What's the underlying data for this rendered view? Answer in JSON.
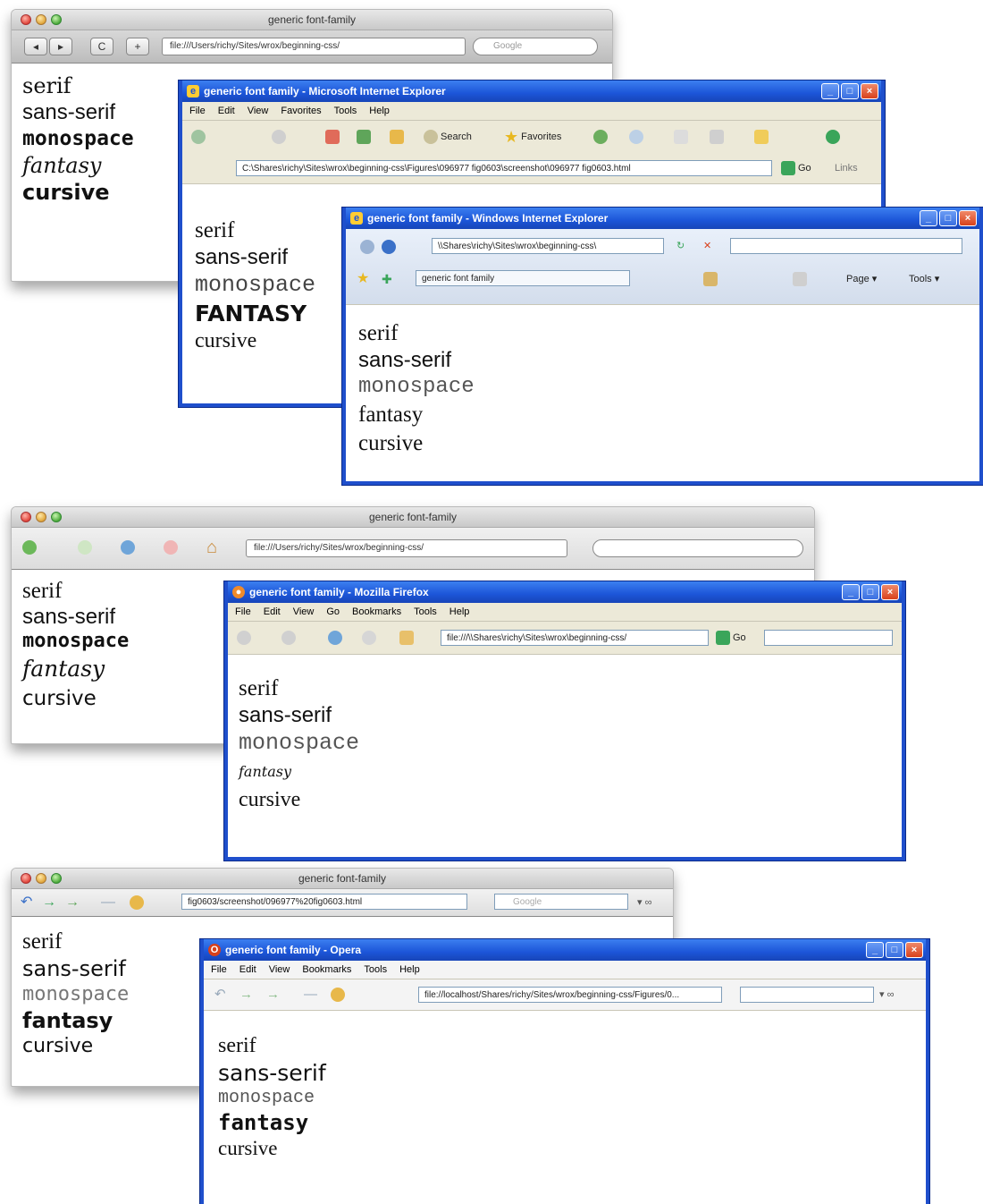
{
  "mac_title": "generic font-family",
  "window1": {
    "address": "file:///Users/richy/Sites/wrox/beginning-css/",
    "search_placeholder": "Google",
    "reload": "C",
    "add": "+",
    "fonts": [
      "serif",
      "sans-serif",
      "monospace",
      "fantasy",
      "cursive"
    ]
  },
  "window2": {
    "title": "generic font family - Microsoft Internet Explorer",
    "menu": [
      "File",
      "Edit",
      "View",
      "Favorites",
      "Tools",
      "Help"
    ],
    "search": "Search",
    "favorites": "Favorites",
    "address": "C:\\Shares\\richy\\Sites\\wrox\\beginning-css\\Figures\\096977 fig0603\\screenshot\\096977 fig0603.html",
    "go": "Go",
    "links": "Links",
    "fonts": [
      "serif",
      "sans-serif",
      "monospace",
      "FANTASY",
      "cursive"
    ]
  },
  "window3": {
    "title": "generic font family - Windows Internet Explorer",
    "address": "\\\\Shares\\richy\\Sites\\wrox\\beginning-css\\",
    "tab": "generic font family",
    "page": "Page",
    "tools": "Tools",
    "fonts": [
      "serif",
      "sans-serif",
      "monospace",
      "fantasy",
      "cursive"
    ]
  },
  "window4": {
    "address": "file:///Users/richy/Sites/wrox/beginning-css/",
    "fonts": [
      "serif",
      "sans-serif",
      "monospace",
      "fantasy",
      "cursive"
    ]
  },
  "window5": {
    "title": "generic font family - Mozilla Firefox",
    "menu": [
      "File",
      "Edit",
      "View",
      "Go",
      "Bookmarks",
      "Tools",
      "Help"
    ],
    "address": "file:///\\\\Shares\\richy\\Sites\\wrox\\beginning-css/",
    "go": "Go",
    "fonts": [
      "serif",
      "sans-serif",
      "monospace",
      "fantasy",
      "cursive"
    ]
  },
  "window6": {
    "address": "fig0603/screenshot/096977%20fig0603.html",
    "search_placeholder": "Google",
    "fonts": [
      "serif",
      "sans-serif",
      "monospace",
      "fantasy",
      "cursive"
    ]
  },
  "window7": {
    "title": "generic font family - Opera",
    "menu": [
      "File",
      "Edit",
      "View",
      "Bookmarks",
      "Tools",
      "Help"
    ],
    "address": "file://localhost/Shares/richy/Sites/wrox/beginning-css/Figures/0...",
    "fonts": [
      "serif",
      "sans-serif",
      "monospace",
      "fantasy",
      "cursive"
    ]
  }
}
